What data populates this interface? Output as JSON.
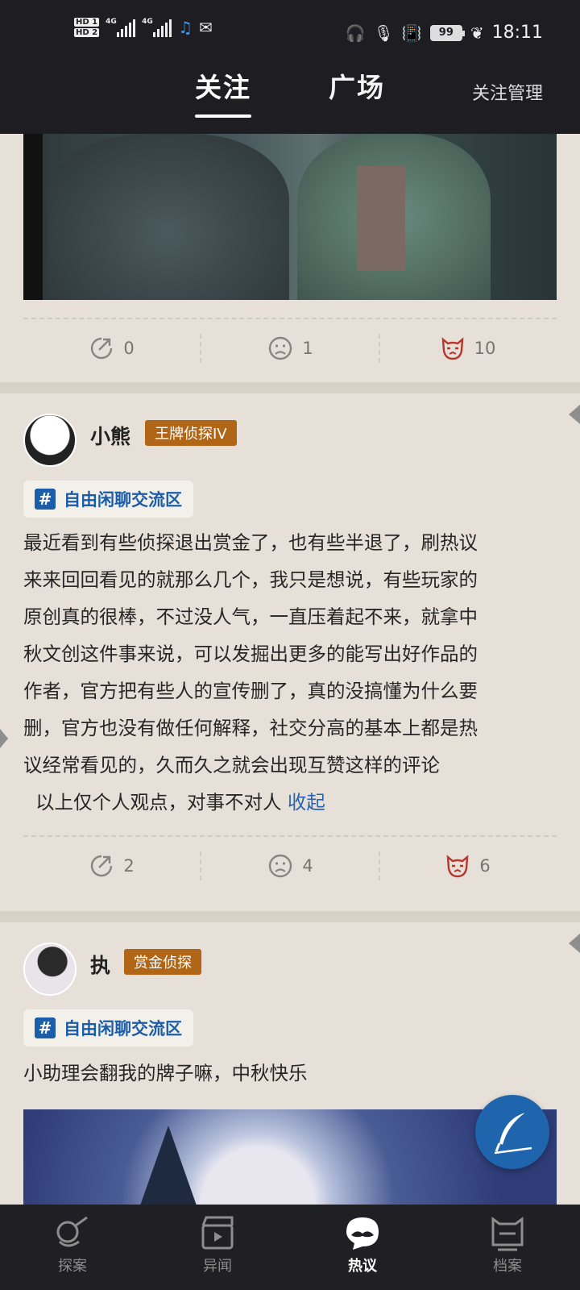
{
  "status_bar": {
    "sim1": "HD 1",
    "sim2": "HD 2",
    "net1": "4G",
    "net2": "4G",
    "battery": "99",
    "time": "18:11"
  },
  "header": {
    "tabs": [
      {
        "label": "关注",
        "active": true
      },
      {
        "label": "广场",
        "active": false
      }
    ],
    "manage_label": "关注管理"
  },
  "posts": [
    {
      "stats": {
        "share": "0",
        "comment": "1",
        "like": "10"
      }
    },
    {
      "user": "小熊",
      "badge": "王牌侦探IV",
      "topic": "自由闲聊交流区",
      "lines": [
        "最近看到有些侦探退出赏金了，也有些半退了，刷热议",
        "来来回回看见的就那么几个，我只是想说，有些玩家的",
        "原创真的很棒，不过没人气，一直压着起不来，就拿中",
        "秋文创这件事来说，可以发掘出更多的能写出好作品的",
        "作者，官方把有些人的宣传删了，真的没搞懂为什么要",
        "删，官方也没有做任何解释，社交分高的基本上都是热",
        "议经常看见的，久而久之就会出现互赞这样的评论",
        "  以上仅个人观点，对事不对人 "
      ],
      "collapse_label": "收起",
      "stats": {
        "share": "2",
        "comment": "4",
        "like": "6"
      }
    },
    {
      "user": "执",
      "badge": "赏金侦探",
      "topic": "自由闲聊交流区",
      "text": "小助理会翻我的牌子嘛，中秋快乐"
    }
  ],
  "bottom_nav": [
    {
      "label": "探案",
      "icon": "magnifier-pipe-icon",
      "active": false
    },
    {
      "label": "异闻",
      "icon": "clapperboard-icon",
      "active": false
    },
    {
      "label": "热议",
      "icon": "mustache-bubble-icon",
      "active": true
    },
    {
      "label": "档案",
      "icon": "profile-cat-icon",
      "active": false
    }
  ],
  "colors": {
    "accent_blue": "#1b5da8",
    "badge_brown": "#b06616",
    "bg": "#e7e0d8",
    "bar": "#1d1d22"
  }
}
